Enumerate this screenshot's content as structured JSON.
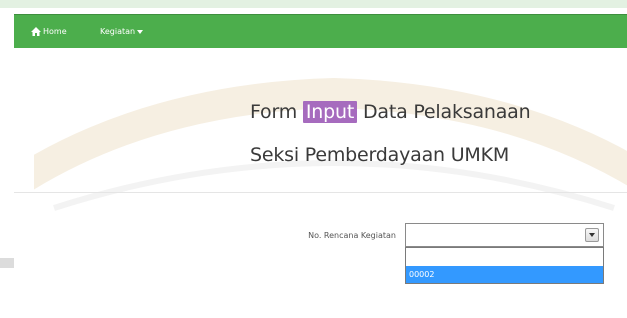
{
  "nav": {
    "home_label": "Home",
    "kegiatan_label": "Kegiatan",
    "bar_color": "#4cae4c"
  },
  "page": {
    "title_line1_prefix": "Form ",
    "title_line1_highlight": "Input",
    "title_line1_suffix": " Data Pelaksanaan",
    "title_line2": "Seksi Pemberdayaan UMKM",
    "highlight_color": "#a66bbe"
  },
  "form": {
    "field_label": "No. Rencana Kegiatan",
    "select_value": "",
    "options": [
      "",
      "00002"
    ],
    "highlighted_option": "00002"
  }
}
